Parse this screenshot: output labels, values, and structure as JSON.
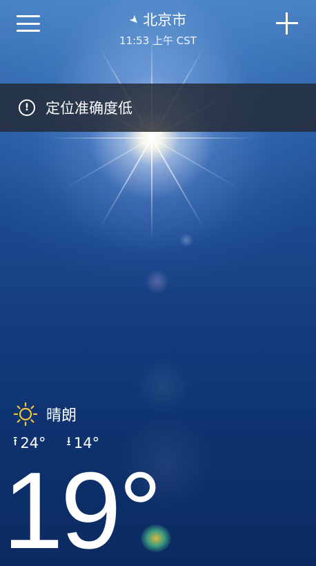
{
  "header": {
    "city": "北京市",
    "time": "11:53 上午 CST",
    "menu_icon": "hamburger-menu-icon",
    "location_icon": "location-arrow-icon",
    "add_icon": "plus-icon"
  },
  "alert": {
    "icon": "exclamation-circle-icon",
    "text": "定位准确度低"
  },
  "current": {
    "condition_icon": "sun-icon",
    "condition": "晴朗",
    "high": "24°",
    "low": "14°",
    "temperature": "19°"
  },
  "colors": {
    "sky_top": "#4a83c4",
    "sky_bottom": "#0b2a60",
    "alert_bar": "#23283280",
    "sun_icon": "#f5c73a"
  }
}
